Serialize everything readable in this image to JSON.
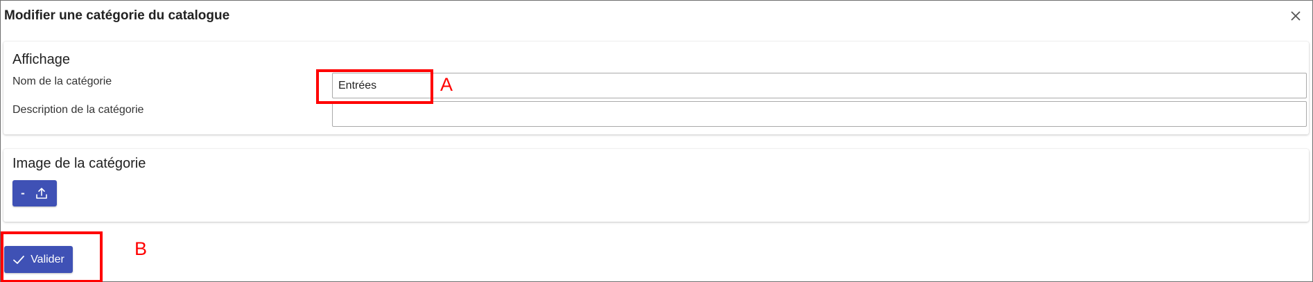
{
  "dialog": {
    "title": "Modifier une catégorie du catalogue",
    "close_icon": "close-icon"
  },
  "display_section": {
    "title": "Affichage",
    "name_label": "Nom de la catégorie",
    "name_value": "Entrées",
    "description_label": "Description de la catégorie",
    "description_value": ""
  },
  "image_section": {
    "title": "Image de la catégorie",
    "upload_button_text": "-",
    "upload_icon": "upload-icon"
  },
  "actions": {
    "submit_label": "Valider",
    "submit_icon": "check-icon"
  },
  "annotations": {
    "a_label": "A",
    "b_label": "B",
    "color": "#ff0000"
  },
  "colors": {
    "primary": "#3f51b5"
  }
}
